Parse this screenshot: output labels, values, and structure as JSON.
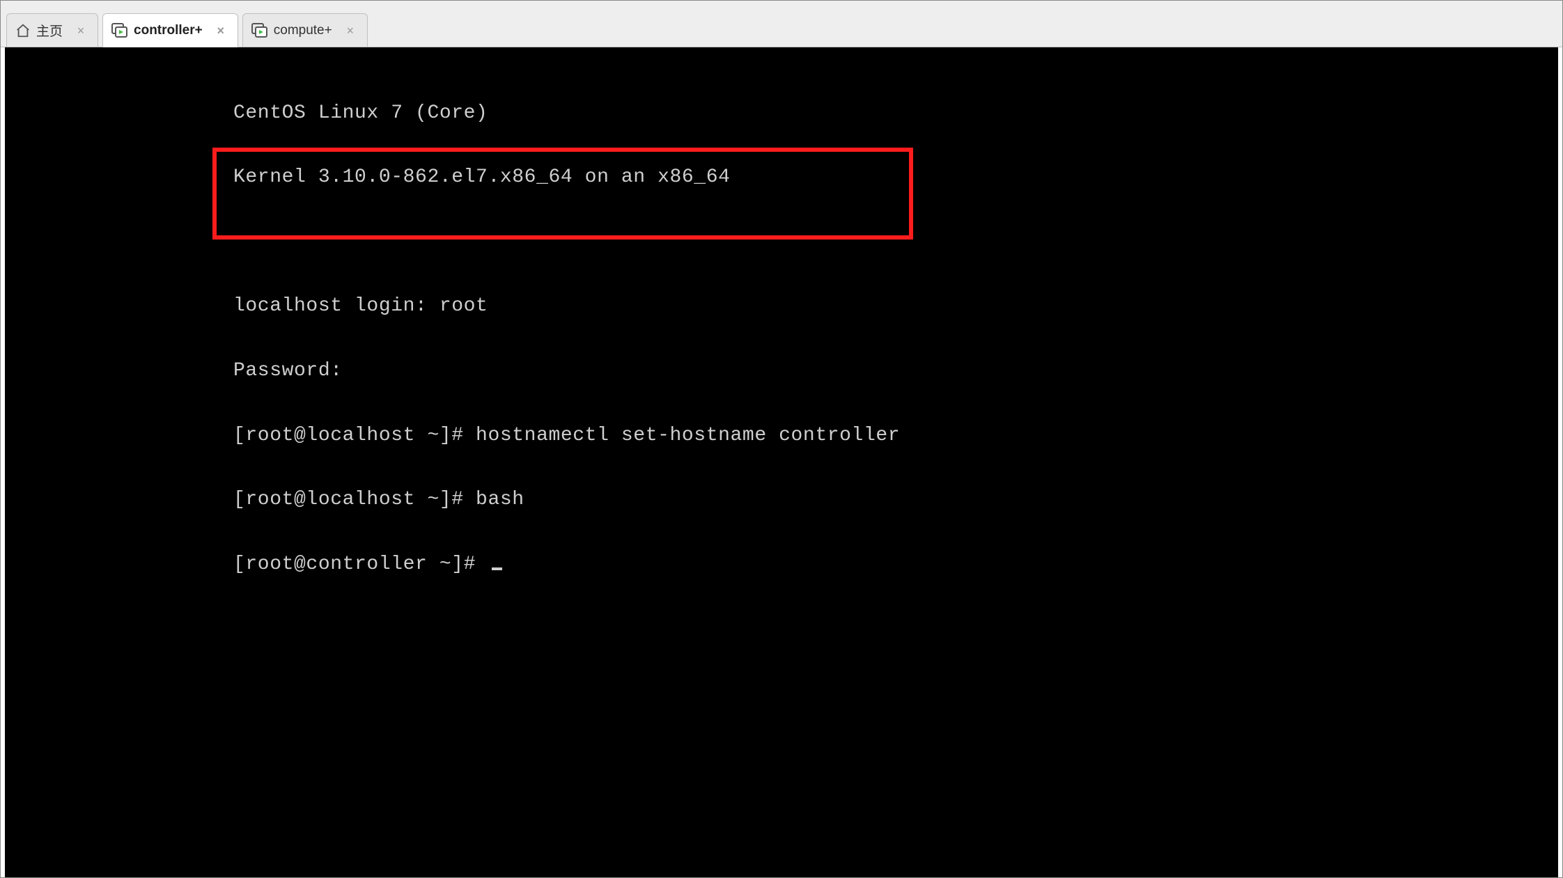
{
  "tabs": [
    {
      "label": "主页",
      "active": false,
      "has_vm_icon": false
    },
    {
      "label": "controller+",
      "active": true,
      "has_vm_icon": true
    },
    {
      "label": "compute+",
      "active": false,
      "has_vm_icon": true
    }
  ],
  "terminal": {
    "line1": "CentOS Linux 7 (Core)",
    "line2": "Kernel 3.10.0-862.el7.x86_64 on an x86_64",
    "blank": "",
    "line3": "localhost login: root",
    "line4": "Password:",
    "line5": "[root@localhost ~]# hostnamectl set-hostname controller",
    "line6": "[root@localhost ~]# bash",
    "line7": "[root@controller ~]# "
  }
}
